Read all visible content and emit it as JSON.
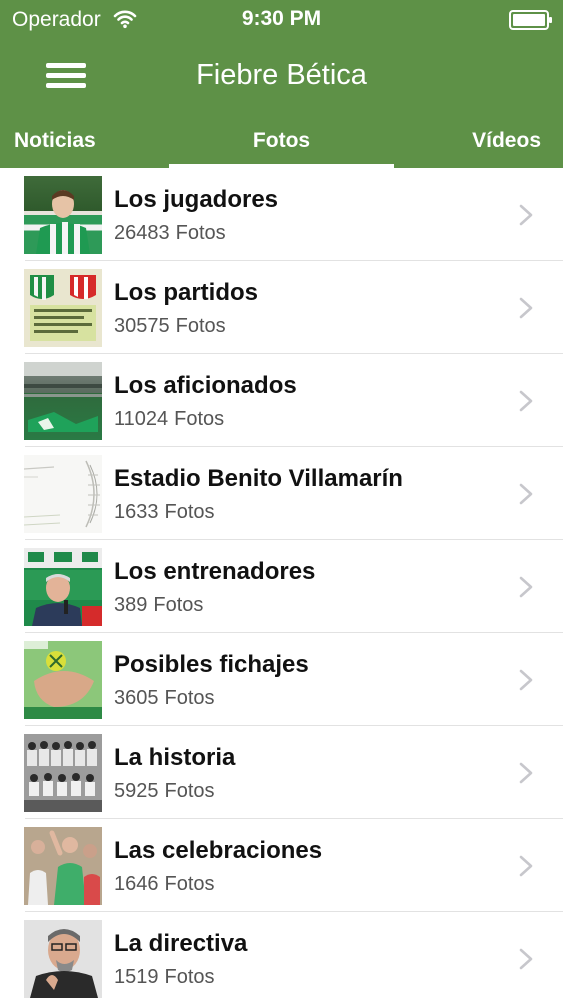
{
  "status_bar": {
    "carrier": "Operador",
    "time": "9:30 PM"
  },
  "nav": {
    "title": "Fiebre Bética",
    "menu_icon": "hamburger-menu-icon"
  },
  "tabs": [
    {
      "label": "Noticias",
      "selected": false
    },
    {
      "label": "Fotos",
      "selected": true
    },
    {
      "label": "Vídeos",
      "selected": false
    }
  ],
  "colors": {
    "brand_green": "#5e9147",
    "text_dark": "#111111",
    "text_gray": "#555555",
    "chevron": "#c7c7cc"
  },
  "albums": [
    {
      "title": "Los jugadores",
      "count": "26483",
      "unit": "Fotos"
    },
    {
      "title": "Los partidos",
      "count": "30575",
      "unit": "Fotos"
    },
    {
      "title": "Los aficionados",
      "count": "11024",
      "unit": "Fotos"
    },
    {
      "title": "Estadio Benito Villamarín",
      "count": "1633",
      "unit": "Fotos"
    },
    {
      "title": "Los entrenadores",
      "count": "389",
      "unit": "Fotos"
    },
    {
      "title": "Posibles fichajes",
      "count": "3605",
      "unit": "Fotos"
    },
    {
      "title": "La historia",
      "count": "5925",
      "unit": "Fotos"
    },
    {
      "title": "Las celebraciones",
      "count": "1646",
      "unit": "Fotos"
    },
    {
      "title": "La directiva",
      "count": "1519",
      "unit": "Fotos"
    }
  ]
}
